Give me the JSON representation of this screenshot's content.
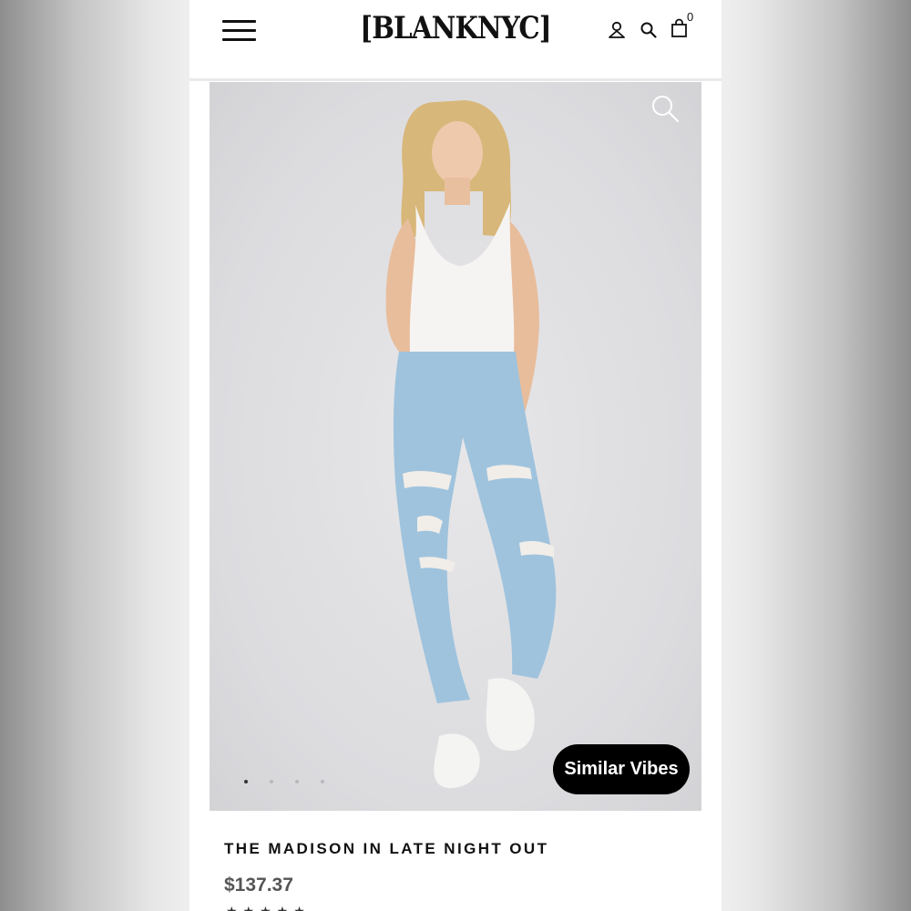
{
  "header": {
    "brand": "[BLANKNYC]",
    "cart_count": "0",
    "menu_icon": "hamburger-menu-icon",
    "account_icon": "account-icon",
    "search_icon": "search-icon",
    "bag_icon": "shopping-bag-icon"
  },
  "gallery": {
    "zoom_icon": "zoom-icon",
    "image_count": 4,
    "active_index": 0,
    "similar_button_label": "Similar Vibes"
  },
  "product": {
    "title": "THE MADISON IN LATE NIGHT OUT",
    "price": "$137.37"
  },
  "colors": {
    "background": "#ffffff",
    "image_bg": "#dcdcdf",
    "button_bg": "#000000",
    "button_text": "#ffffff",
    "price": "#555555",
    "denim": "#9fc3dd",
    "top": "#f6f4f2"
  }
}
